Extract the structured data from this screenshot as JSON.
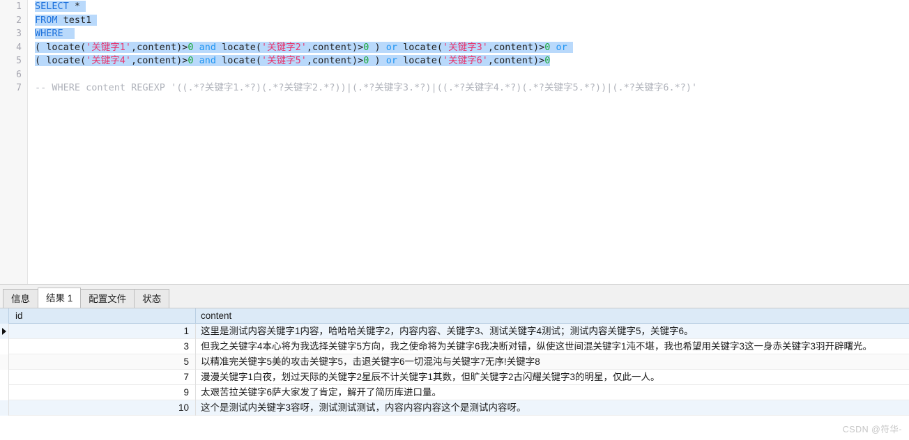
{
  "editor": {
    "line_numbers": [
      "1",
      "2",
      "3",
      "4",
      "5",
      "6",
      "7"
    ],
    "lines": [
      {
        "n": "1",
        "segments": [
          {
            "t": "SELECT",
            "c": "kw",
            "sel": true
          },
          {
            "t": " ",
            "c": "plain",
            "sel": true
          },
          {
            "t": "*",
            "c": "plain",
            "sel": true
          },
          {
            "t": " ",
            "c": "plain",
            "sel": true
          }
        ]
      },
      {
        "n": "2",
        "segments": [
          {
            "t": "FROM",
            "c": "kw",
            "sel": true
          },
          {
            "t": " test1 ",
            "c": "plain",
            "sel": true
          }
        ]
      },
      {
        "n": "3",
        "segments": [
          {
            "t": "WHERE",
            "c": "kw",
            "sel": true
          },
          {
            "t": "  ",
            "c": "plain",
            "sel": true
          }
        ]
      },
      {
        "n": "4",
        "segments": [
          {
            "t": "( locate(",
            "c": "plain",
            "sel": true
          },
          {
            "t": "'关键字1'",
            "c": "str",
            "sel": true
          },
          {
            "t": ",content)>",
            "c": "plain",
            "sel": true
          },
          {
            "t": "0",
            "c": "num",
            "sel": true
          },
          {
            "t": " ",
            "c": "plain",
            "sel": true
          },
          {
            "t": "and",
            "c": "op",
            "sel": true
          },
          {
            "t": " locate(",
            "c": "plain",
            "sel": true
          },
          {
            "t": "'关键字2'",
            "c": "str",
            "sel": true
          },
          {
            "t": ",content)>",
            "c": "plain",
            "sel": true
          },
          {
            "t": "0",
            "c": "num",
            "sel": true
          },
          {
            "t": " ) ",
            "c": "plain",
            "sel": true
          },
          {
            "t": "or",
            "c": "op",
            "sel": true
          },
          {
            "t": " locate(",
            "c": "plain",
            "sel": true
          },
          {
            "t": "'关键字3'",
            "c": "str",
            "sel": true
          },
          {
            "t": ",content)>",
            "c": "plain",
            "sel": true
          },
          {
            "t": "0",
            "c": "num",
            "sel": true
          },
          {
            "t": " ",
            "c": "plain",
            "sel": true
          },
          {
            "t": "or",
            "c": "op",
            "sel": true
          },
          {
            "t": " ",
            "c": "plain",
            "sel": true
          }
        ]
      },
      {
        "n": "5",
        "segments": [
          {
            "t": "( locate(",
            "c": "plain",
            "sel": true
          },
          {
            "t": "'关键字4'",
            "c": "str",
            "sel": true
          },
          {
            "t": ",content)>",
            "c": "plain",
            "sel": true
          },
          {
            "t": "0",
            "c": "num",
            "sel": true
          },
          {
            "t": " ",
            "c": "plain",
            "sel": true
          },
          {
            "t": "and",
            "c": "op",
            "sel": true
          },
          {
            "t": " locate(",
            "c": "plain",
            "sel": true
          },
          {
            "t": "'关键字5'",
            "c": "str",
            "sel": true
          },
          {
            "t": ",content)>",
            "c": "plain",
            "sel": true
          },
          {
            "t": "0",
            "c": "num",
            "sel": true
          },
          {
            "t": " ) ",
            "c": "plain",
            "sel": true
          },
          {
            "t": "or",
            "c": "op",
            "sel": true
          },
          {
            "t": " locate(",
            "c": "plain",
            "sel": true
          },
          {
            "t": "'关键字6'",
            "c": "str",
            "sel": true
          },
          {
            "t": ",content)>",
            "c": "plain",
            "sel": true
          },
          {
            "t": "0",
            "c": "num",
            "sel": true
          }
        ]
      },
      {
        "n": "6",
        "segments": []
      },
      {
        "n": "7",
        "segments": [
          {
            "t": "-- WHERE content REGEXP '((.*?关键字1.*?)(.*?关键字2.*?))|(.*?关键字3.*?)|((.*?关键字4.*?)(.*?关键字5.*?))|(.*?关键字6.*?)'",
            "c": "comment",
            "sel": false
          }
        ]
      }
    ]
  },
  "tabs": [
    {
      "label": "信息",
      "active": false
    },
    {
      "label": "结果 1",
      "active": true
    },
    {
      "label": "配置文件",
      "active": false
    },
    {
      "label": "状态",
      "active": false
    }
  ],
  "grid": {
    "columns": [
      "id",
      "content"
    ],
    "rows": [
      {
        "id": "1",
        "content": "这里是测试内容关键字1内容，哈哈哈关键字2，内容内容、关键字3、测试关键字4测试；测试内容关键字5，关键字6。",
        "selected": true
      },
      {
        "id": "3",
        "content": "但我之关键字4本心将为我选择关键字5方向，我之使命将为关键字6我决断对错，纵使这世间混关键字1沌不堪，我也希望用关键字3这一身赤关键字3羽开辟曙光。",
        "selected": false
      },
      {
        "id": "5",
        "content": "以精准完关键字5美的攻击关键字5，击退关键字6一切混沌与关键字7无序!关键字8",
        "selected": false
      },
      {
        "id": "7",
        "content": "漫漫关键字1白夜，划过天际的关键字2星辰不计关键字1其数，但旷关键字2古闪耀关键字3的明星，仅此一人。",
        "selected": false
      },
      {
        "id": "9",
        "content": "太艰苦拉关键字6萨大家发了肯定，解开了简历库进口量。",
        "selected": false
      },
      {
        "id": "10",
        "content": "这个是测试内关键字3容呀，测试测试测试，内容内容内容这个是测试内容呀。",
        "selected": false
      }
    ]
  },
  "watermark": {
    "text": "CSDN @符华-"
  },
  "colors": {
    "selection": "#b9d9fb",
    "keyword": "#1a6fdb",
    "string": "#e8376f",
    "number": "#1aa83a",
    "operator": "#2196f3",
    "comment": "#b0b3bb",
    "grid_header": "#dceaf7"
  }
}
